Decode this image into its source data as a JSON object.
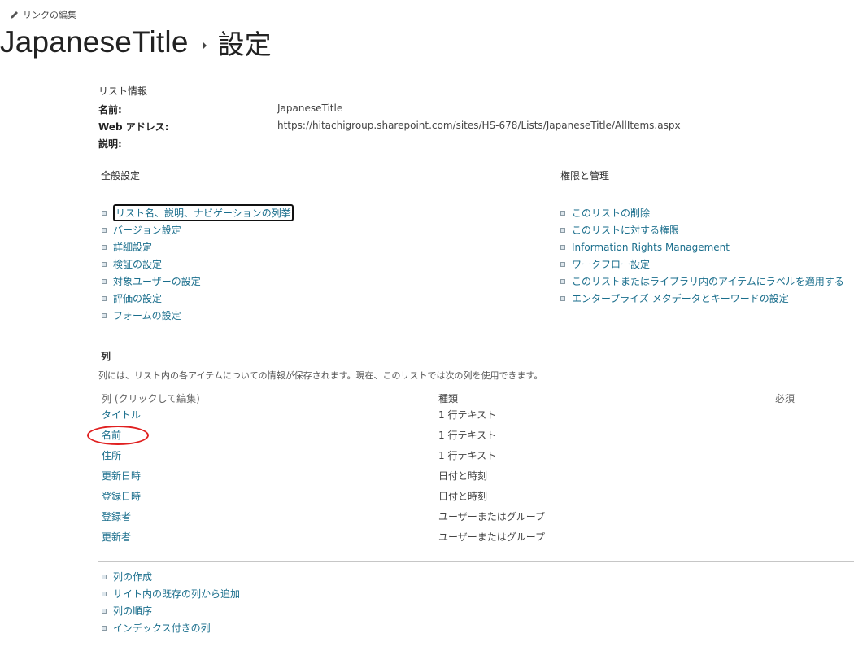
{
  "header": {
    "edit_links": "リンクの編集",
    "site_title": "JapaneseTitle",
    "page_title": "設定"
  },
  "list_info": {
    "heading": "リスト情報",
    "rows": [
      {
        "key": "名前:",
        "value": "JapaneseTitle"
      },
      {
        "key": "Web アドレス:",
        "value": "https://hitachigroup.sharepoint.com/sites/HS-678/Lists/JapaneseTitle/AllItems.aspx"
      },
      {
        "key": "説明:",
        "value": ""
      }
    ]
  },
  "general_settings": {
    "heading": "全般設定",
    "links": [
      "リスト名、説明、ナビゲーションの列挙",
      "バージョン設定",
      "詳細設定",
      "検証の設定",
      "対象ユーザーの設定",
      "評価の設定",
      "フォームの設定"
    ]
  },
  "permissions": {
    "heading": "権限と管理",
    "links": [
      "このリストの削除",
      "このリストに対する権限",
      "Information Rights Management",
      "ワークフロー設定",
      "このリストまたはライブラリ内のアイテムにラベルを適用する",
      "エンタープライズ メタデータとキーワードの設定"
    ]
  },
  "columns": {
    "heading": "列",
    "description": "列には、リスト内の各アイテムについての情報が保存されます。現在、このリストでは次の列を使用できます。",
    "headers": {
      "name": "列 (クリックして編集)",
      "type": "種類",
      "required": "必須"
    },
    "rows": [
      {
        "name": "タイトル",
        "type": "1 行テキスト",
        "required": ""
      },
      {
        "name": "名前",
        "type": "1 行テキスト",
        "required": ""
      },
      {
        "name": "住所",
        "type": "1 行テキスト",
        "required": ""
      },
      {
        "name": "更新日時",
        "type": "日付と時刻",
        "required": ""
      },
      {
        "name": "登録日時",
        "type": "日付と時刻",
        "required": ""
      },
      {
        "name": "登録者",
        "type": "ユーザーまたはグループ",
        "required": ""
      },
      {
        "name": "更新者",
        "type": "ユーザーまたはグループ",
        "required": ""
      }
    ],
    "actions": [
      "列の作成",
      "サイト内の既存の列から追加",
      "列の順序",
      "インデックス付きの列"
    ]
  },
  "colors": {
    "link": "#1a6e8c",
    "annotation": "#e02020"
  }
}
